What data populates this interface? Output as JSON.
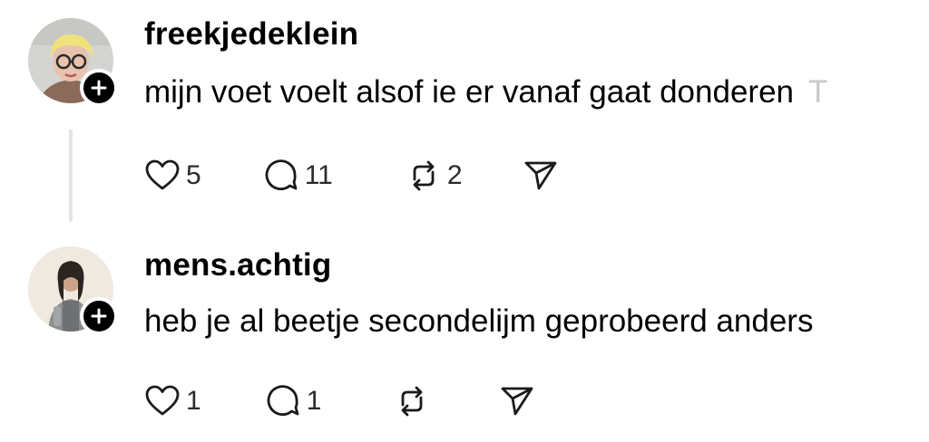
{
  "posts": [
    {
      "username": "freekjedeklein",
      "text": "mijn voet voelt alsof ie er vanaf gaat donderen",
      "trailing_text": "T",
      "likes": "5",
      "replies": "11",
      "reposts": "2",
      "avatar_icon": "avatar-person-glasses",
      "follow_icon": "plus-icon"
    },
    {
      "username": "mens.achtig",
      "text": "heb je al beetje secondelijm geprobeerd anders",
      "likes": "1",
      "replies": "1",
      "reposts": "",
      "avatar_icon": "avatar-person-armor",
      "follow_icon": "plus-icon"
    }
  ],
  "colors": {
    "text": "#000000",
    "icon": "#1a1a1a",
    "thread_line": "#e4e4e4",
    "faded_text": "#c9c9c9"
  }
}
